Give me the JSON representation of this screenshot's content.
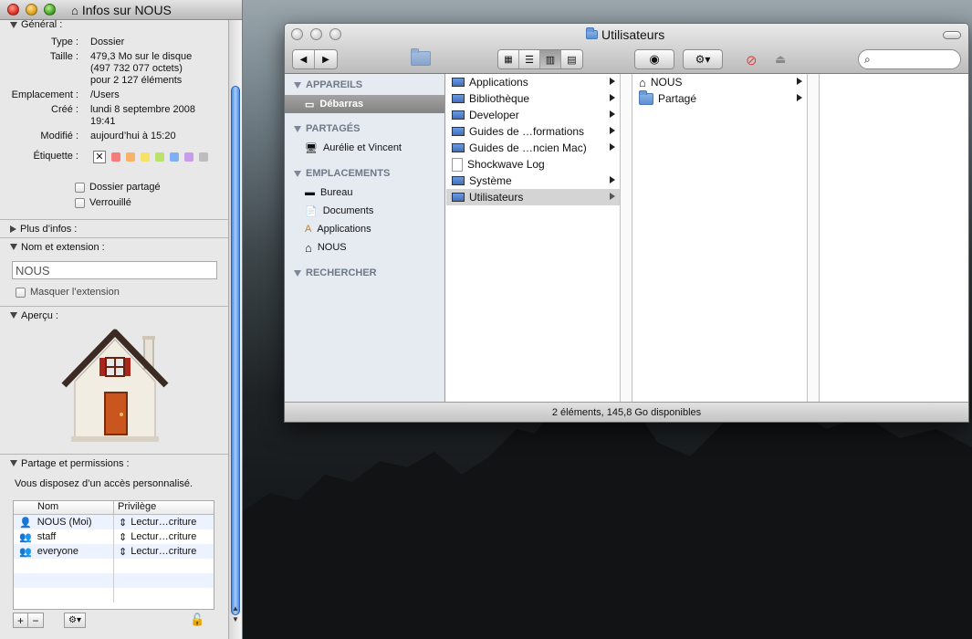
{
  "info": {
    "title": "Infos sur NOUS",
    "general_label": "Général :",
    "type_k": "Type :",
    "type_v": "Dossier",
    "size_k": "Taille :",
    "size_v1": "479,3 Mo sur le disque",
    "size_v2": "(497 732 077 octets)",
    "size_v3": "pour 2 127 éléments",
    "location_k": "Emplacement :",
    "location_v": "/Users",
    "created_k": "Créé :",
    "created_v1": "lundi 8 septembre 2008",
    "created_v2": "19:41",
    "modified_k": "Modifié :",
    "modified_v": "aujourd’hui à 15:20",
    "label_k": "Étiquette :",
    "label_none": "✕",
    "label_colors": [
      "#f77b7b",
      "#f8b367",
      "#f6e267",
      "#b9e16b",
      "#7fb1f2",
      "#c79ce9",
      "#bdbdbd"
    ],
    "shared_folder": "Dossier partagé",
    "locked": "Verrouillé",
    "more_info": "Plus d’infos :",
    "name_ext": "Nom et extension :",
    "name_value": "NOUS",
    "hide_ext": "Masquer l’extension",
    "preview": "Aperçu :",
    "sharing": "Partage et permissions :",
    "access_text": "Vous disposez d’un accès personnalisé.",
    "perm_headers": {
      "name": "Nom",
      "privilege": "Privilège"
    },
    "perm_rows": [
      {
        "name": "NOUS (Moi)",
        "priv": "Lectur…criture"
      },
      {
        "name": "staff",
        "priv": "Lectur…criture"
      },
      {
        "name": "everyone",
        "priv": "Lectur…criture"
      }
    ],
    "add": "+",
    "remove": "−",
    "gear": "⚙▾",
    "lock": "🔓"
  },
  "finder": {
    "title": "Utilisateurs",
    "status": "2 éléments, 145,8 Go disponibles",
    "sidebar": {
      "devices_label": "APPAREILS",
      "device": "Débarras",
      "shared_label": "PARTAGÉS",
      "shared": "Aurélie et Vincent",
      "places_label": "EMPLACEMENTS",
      "places": [
        "Bureau",
        "Documents",
        "Applications",
        "NOUS"
      ],
      "search_label": "RECHERCHER"
    },
    "column1": [
      "Applications",
      "Bibliothèque",
      "Developer",
      "Guides de …formations",
      "Guides de …ncien Mac)",
      "Shockwave Log",
      "Système",
      "Utilisateurs"
    ],
    "column2": [
      "NOUS",
      "Partagé"
    ]
  }
}
